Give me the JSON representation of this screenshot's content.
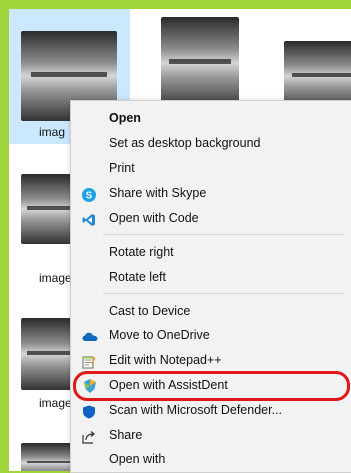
{
  "files": [
    {
      "label": "imag",
      "selected": true
    },
    {
      "label": ""
    },
    {
      "label": ""
    },
    {
      "label": "image"
    },
    {
      "label": "image"
    },
    {
      "label": "image"
    }
  ],
  "menu": {
    "open": "Open",
    "set_bg": "Set as desktop background",
    "print": "Print",
    "share_skype": "Share with Skype",
    "open_code": "Open with Code",
    "rotate_right": "Rotate right",
    "rotate_left": "Rotate left",
    "cast": "Cast to Device",
    "onedrive": "Move to OneDrive",
    "notepad": "Edit with Notepad++",
    "assistdent": "Open with AssistDent",
    "defender": "Scan with Microsoft Defender...",
    "share": "Share",
    "open_with": "Open with"
  },
  "icons": {
    "skype": "skype-icon",
    "vscode": "vscode-icon",
    "onedrive": "onedrive-icon",
    "notepad": "notepad-icon",
    "assistdent": "assistdent-icon",
    "defender": "defender-icon",
    "share": "share-icon"
  },
  "colors": {
    "background": "#9fd53a",
    "selection": "#cce8ff",
    "highlight_ring": "#e01818"
  }
}
